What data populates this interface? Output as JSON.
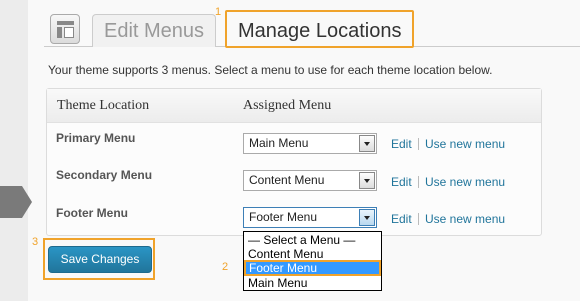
{
  "tabs": {
    "edit_label": "Edit Menus",
    "manage_label": "Manage Locations"
  },
  "markers": {
    "one": "1",
    "two": "2",
    "three": "3"
  },
  "intro": "Your theme supports 3 menus. Select a menu to use for each theme location below.",
  "table": {
    "col_location": "Theme Location",
    "col_assigned": "Assigned Menu",
    "rows": [
      {
        "label": "Primary Menu",
        "value": "Main Menu",
        "edit": "Edit",
        "use_new": "Use new menu"
      },
      {
        "label": "Secondary Menu",
        "value": "Content Menu",
        "edit": "Edit",
        "use_new": "Use new menu"
      },
      {
        "label": "Footer Menu",
        "value": "Footer Menu",
        "edit": "Edit",
        "use_new": "Use new menu"
      }
    ]
  },
  "dropdown": {
    "options": [
      "— Select a Menu —",
      "Content Menu",
      "Footer Menu",
      "Main Menu"
    ],
    "selected": "Footer Menu"
  },
  "save_label": "Save Changes",
  "colors": {
    "highlight": "#f0a32b",
    "link": "#21759b",
    "button": "#21759b",
    "selection": "#3399ff"
  }
}
